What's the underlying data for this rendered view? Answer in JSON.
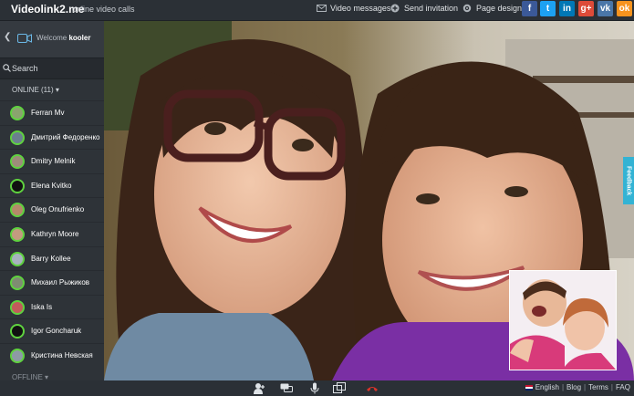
{
  "header": {
    "logo": "Videolink2.me",
    "tagline": "online video calls",
    "nav": [
      {
        "label": "Video messages",
        "icon": "envelope-icon"
      },
      {
        "label": "Send invitation",
        "icon": "plus-circle-icon"
      },
      {
        "label": "Page design",
        "icon": "gear-icon"
      }
    ],
    "social": [
      {
        "name": "facebook",
        "glyph": "f",
        "color": "#3b5998"
      },
      {
        "name": "twitter",
        "glyph": "t",
        "color": "#1da1f2"
      },
      {
        "name": "linkedin",
        "glyph": "in",
        "color": "#0077b5"
      },
      {
        "name": "google-plus",
        "glyph": "g+",
        "color": "#dd4b39"
      },
      {
        "name": "vk",
        "glyph": "vk",
        "color": "#4a76a8"
      },
      {
        "name": "odnoklassniki",
        "glyph": "ok",
        "color": "#f7931e"
      }
    ]
  },
  "sidebar": {
    "welcome_prefix": "Welcome",
    "username": "kooler",
    "search_placeholder": "Search",
    "online_label": "ONLINE (11)",
    "offline_label": "OFFLINE",
    "contacts": [
      {
        "name": "Ferran Mv",
        "avatar": "#8aa36e"
      },
      {
        "name": "Дмитрий Федоренко",
        "avatar": "#6b7f8f"
      },
      {
        "name": "Dmitry Melnik",
        "avatar": "#9d8c7a"
      },
      {
        "name": "Elena Kvitko",
        "avatar": "#111111"
      },
      {
        "name": "Oleg Onufrienko",
        "avatar": "#b48a6a"
      },
      {
        "name": "Kathryn Moore",
        "avatar": "#c29b7f"
      },
      {
        "name": "Barry Kollee",
        "avatar": "#a7b3be"
      },
      {
        "name": "Михаил Рыжиков",
        "avatar": "#7f8c72"
      },
      {
        "name": "Iska Is",
        "avatar": "#c25b5b"
      },
      {
        "name": "Igor Goncharuk",
        "avatar": "#111111"
      },
      {
        "name": "Кристина Невская",
        "avatar": "#8d9aa6"
      }
    ]
  },
  "video": {
    "feedback_label": "Feedback"
  },
  "controls": [
    "add-user-icon",
    "chat-icon",
    "microphone-icon",
    "screen-share-icon",
    "hangup-icon"
  ],
  "footer": {
    "language": "English",
    "links": [
      "Blog",
      "Terms",
      "FAQ"
    ]
  },
  "colors": {
    "online_ring": "#5fd23f",
    "hangup": "#d9342b",
    "feedback_tab": "#33b3d4"
  }
}
